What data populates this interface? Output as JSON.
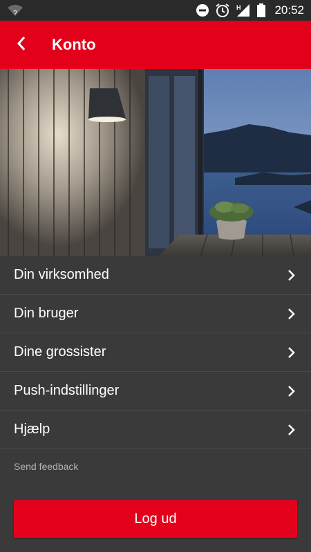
{
  "status_bar": {
    "time": "20:52",
    "network_type": "H",
    "icons": [
      "wifi-unknown-icon",
      "do-not-disturb-icon",
      "alarm-icon",
      "signal-icon",
      "battery-icon"
    ]
  },
  "app_bar": {
    "title": "Konto",
    "back_icon": "chevron-left-icon"
  },
  "hero": {
    "image": "outdoor-wall-lamp-on-wooden-facade-by-lake-at-dusk"
  },
  "menu": {
    "items": [
      {
        "label": "Din virksomhed",
        "icon": "chevron-right-icon"
      },
      {
        "label": "Din bruger",
        "icon": "chevron-right-icon"
      },
      {
        "label": "Dine grossister",
        "icon": "chevron-right-icon"
      },
      {
        "label": "Push-indstillinger",
        "icon": "chevron-right-icon"
      },
      {
        "label": "Hjælp",
        "icon": "chevron-right-icon"
      }
    ]
  },
  "feedback_link": "Send feedback",
  "logout_button": "Log ud",
  "colors": {
    "brand_red": "#e3001b",
    "background": "#3a3a3a",
    "status_bar": "#2a2a2a",
    "secondary_text": "#b4b4b4"
  }
}
